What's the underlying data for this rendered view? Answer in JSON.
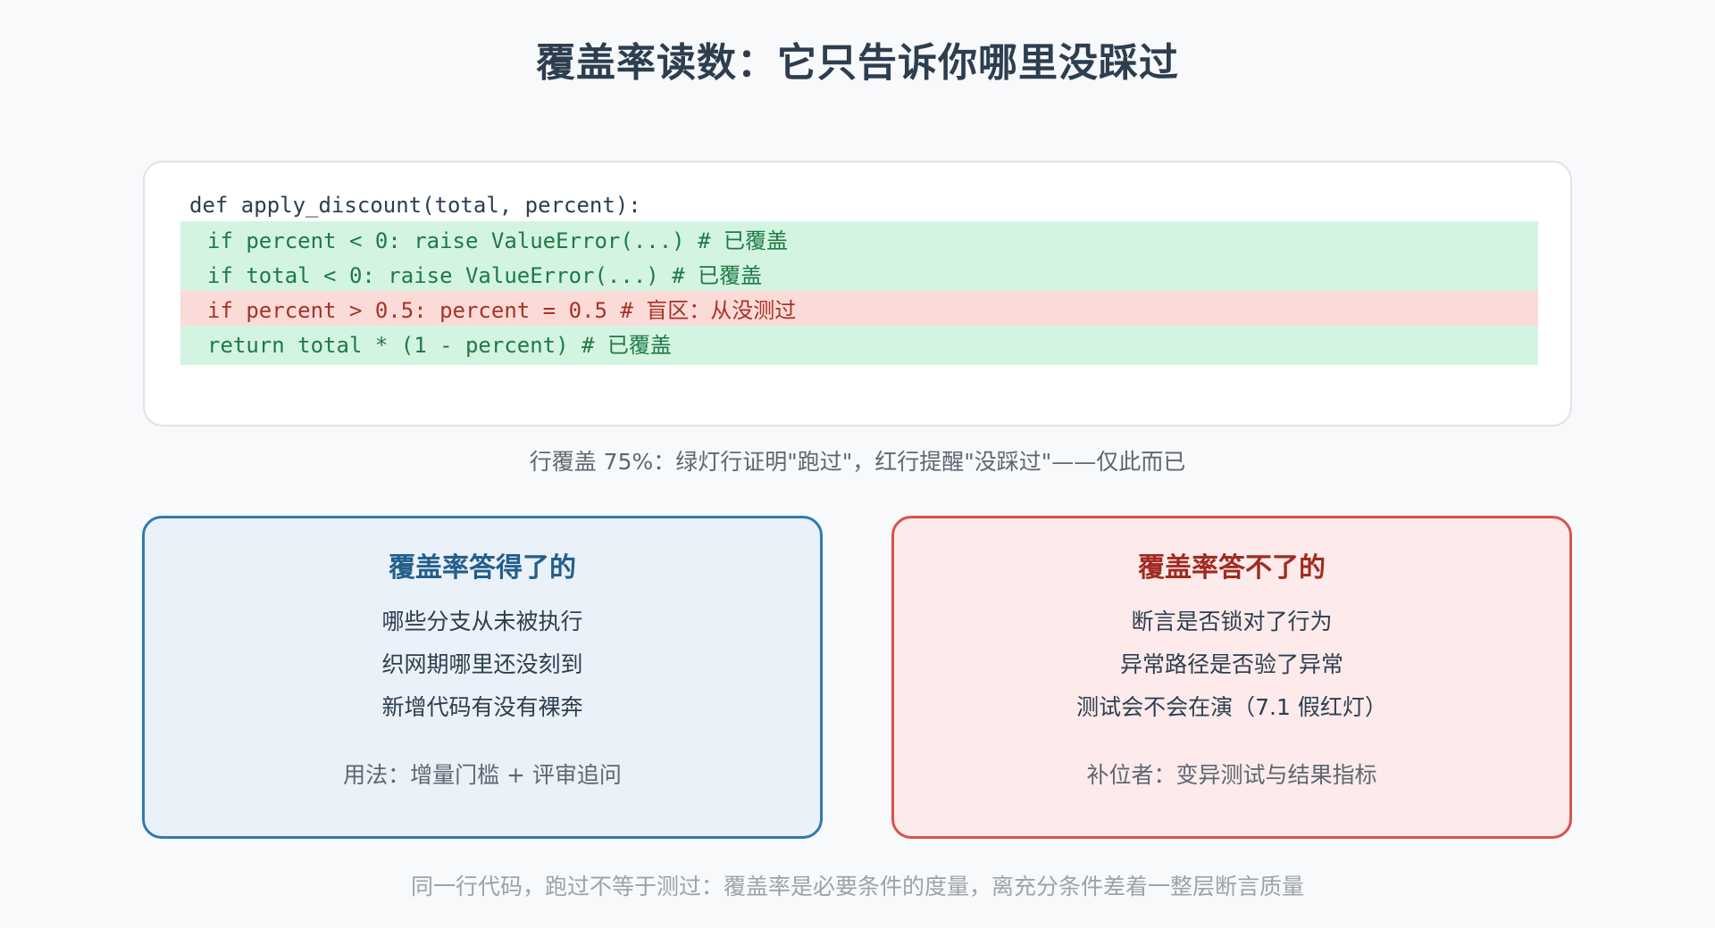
{
  "title": "覆盖率读数：它只告诉你哪里没踩过",
  "code": {
    "header": "def apply_discount(total, percent):",
    "lines": [
      {
        "text": "if percent < 0: raise ValueError(...) # 已覆盖",
        "status": "covered"
      },
      {
        "text": "if total < 0: raise ValueError(...) # 已覆盖",
        "status": "covered"
      },
      {
        "text": "if percent > 0.5: percent = 0.5 # 盲区：从没测过",
        "status": "uncovered"
      },
      {
        "text": "return total * (1 - percent) # 已覆盖",
        "status": "covered"
      }
    ],
    "colors": {
      "covered_bg": "#d4f4e2",
      "covered_text": "#1e7a46",
      "uncovered_bg": "#fadbd8",
      "uncovered_text": "#a93226"
    }
  },
  "caption": "行覆盖 75%：绿灯行证明\"跑过\"，红行提醒\"没踩过\"——仅此而已",
  "panels": {
    "can": {
      "title": "覆盖率答得了的",
      "items": [
        "哪些分支从未被执行",
        "织网期哪里还没刻到",
        "新增代码有没有裸奔"
      ],
      "note": "用法：增量门槛 + 评审追问",
      "accent": "#2e7bb0"
    },
    "cannot": {
      "title": "覆盖率答不了的",
      "items": [
        "断言是否锁对了行为",
        "异常路径是否验了异常",
        "测试会不会在演（7.1 假红灯）"
      ],
      "note": "补位者：变异测试与结果指标",
      "accent": "#d9534a"
    }
  },
  "footer": "同一行代码，跑过不等于测过：覆盖率是必要条件的度量，离充分条件差着一整层断言质量"
}
